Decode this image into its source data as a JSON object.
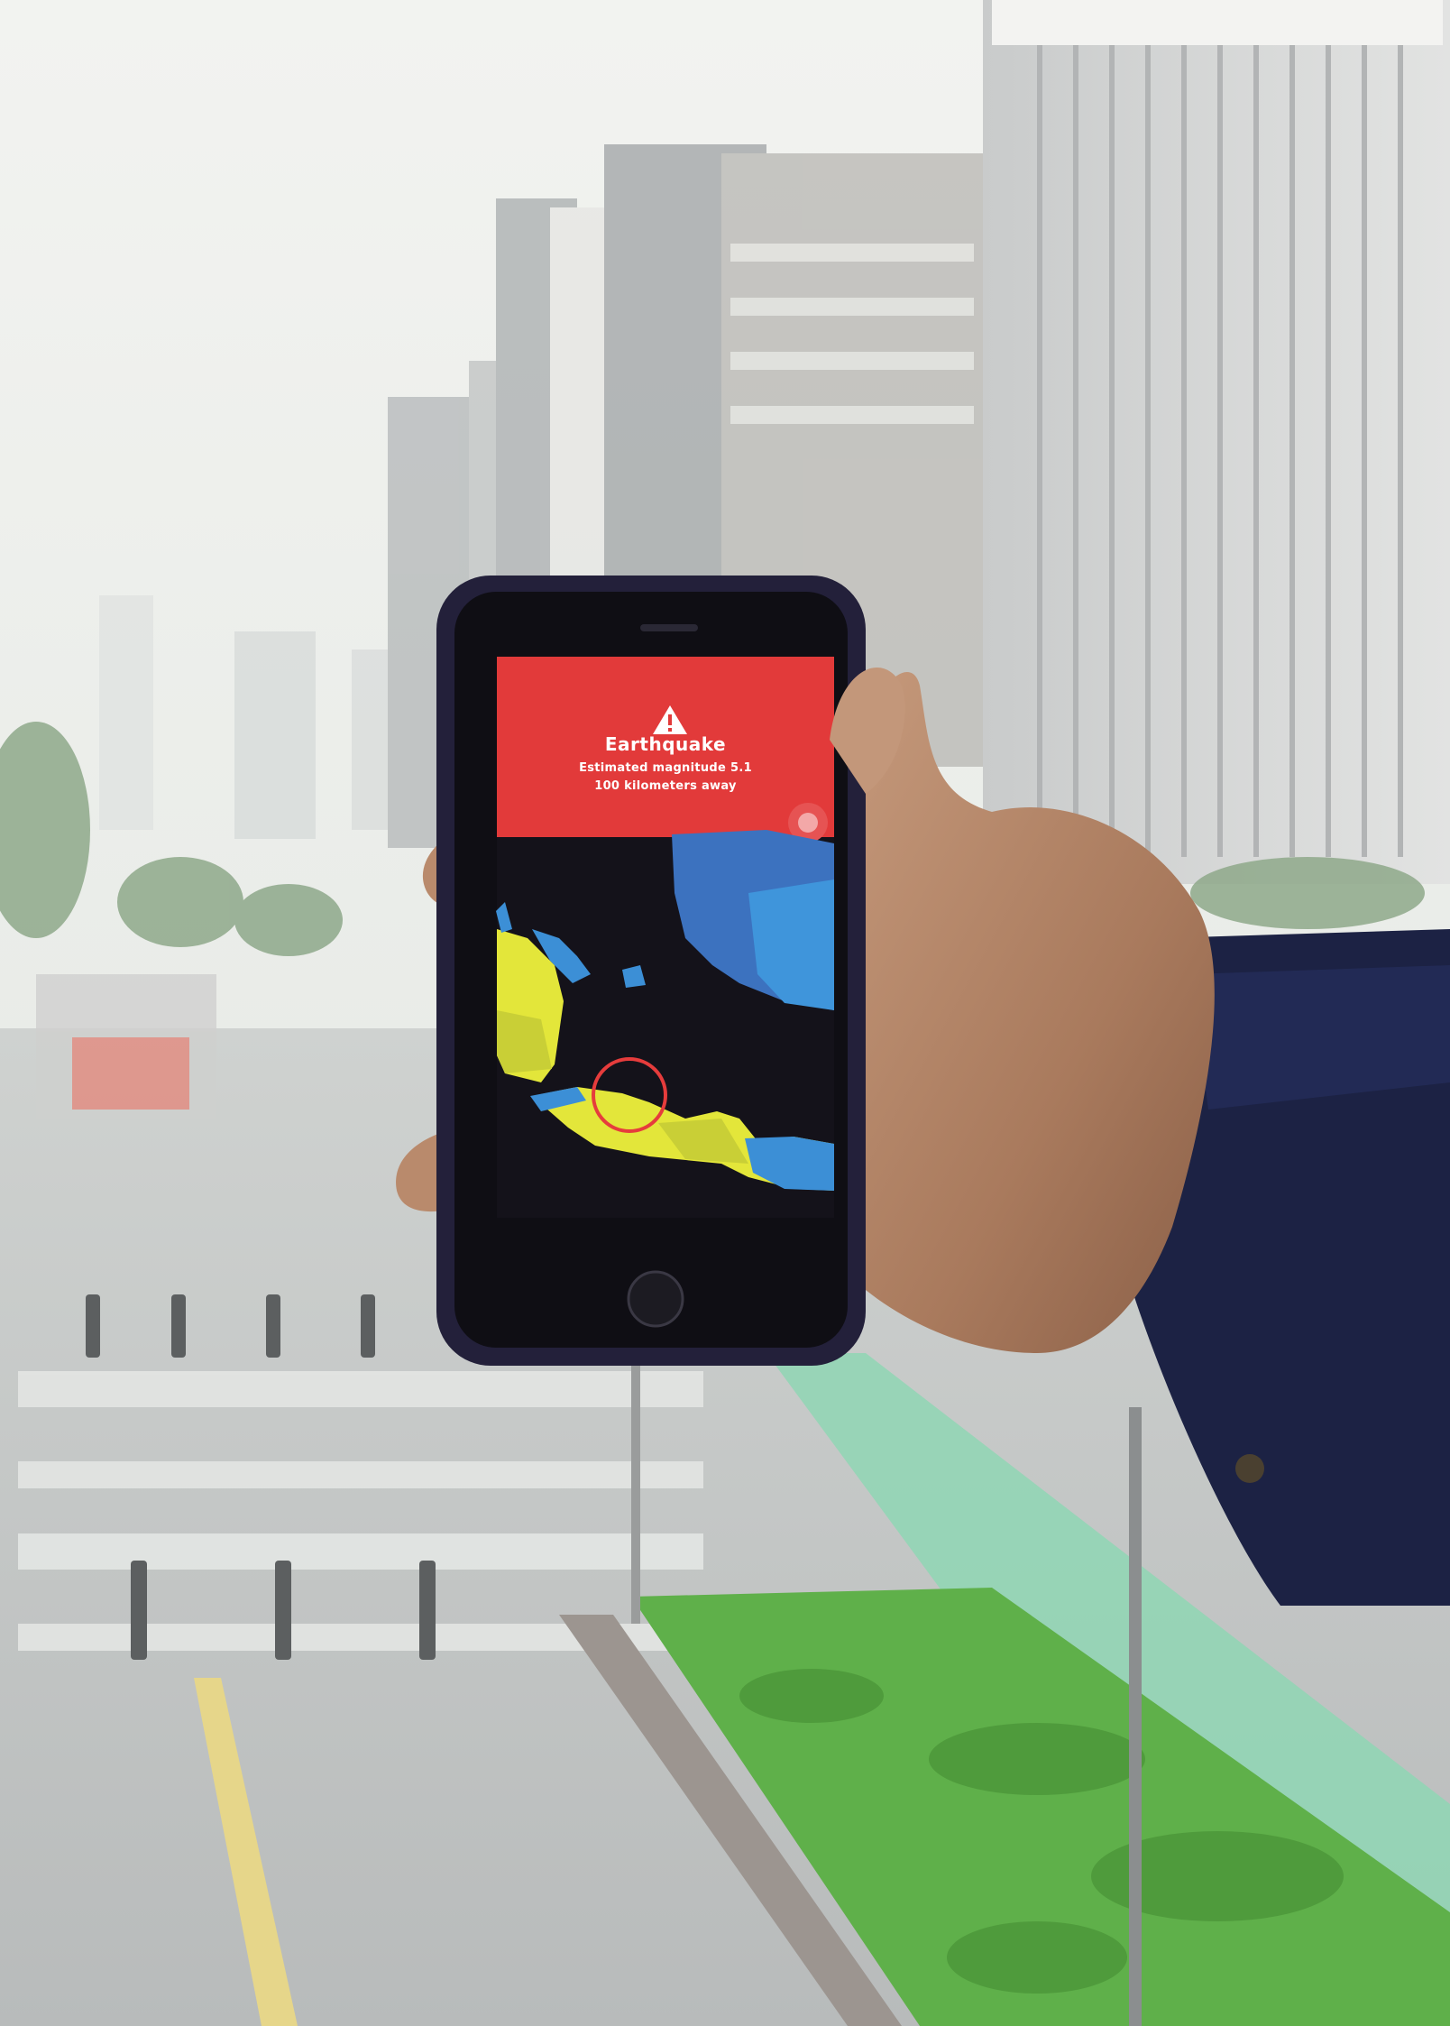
{
  "alert": {
    "title": "Earthquake",
    "magnitude_text": "Estimated magnitude 5.1",
    "distance_text": "100 kilometers away"
  },
  "colors": {
    "alert_banner": "#e23a3a",
    "map_background": "#14121a",
    "region_blue": "#3c8fd6",
    "region_yellow": "#e3e63a",
    "epicenter_ring": "#e63c3c",
    "phone_case": "#23203a",
    "sleeve": "#1c2244",
    "grass": "#5fb04a",
    "bike_lane": "#8fd6b4"
  },
  "icons": {
    "warning": "warning-triangle-icon",
    "record": "record-dot-icon",
    "home": "home-button-icon"
  }
}
